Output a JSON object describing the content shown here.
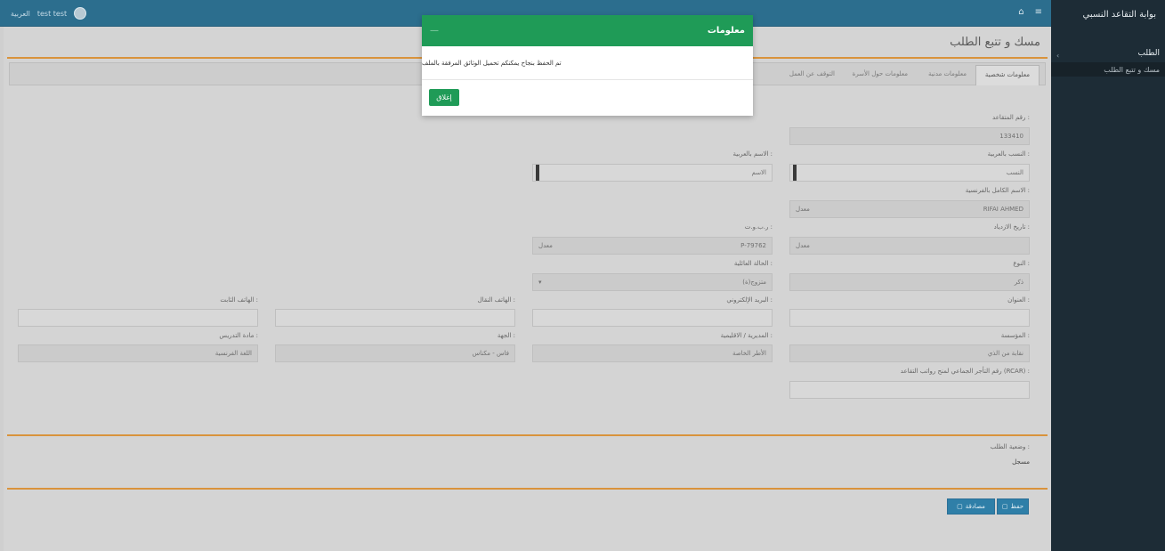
{
  "sidebar": {
    "brand": "بوابة التقاعد النسبي",
    "menu_main": "الطلب",
    "menu_sub": "مسك و تتبع الطلب"
  },
  "navbar": {
    "username": "test test",
    "language": "العربية"
  },
  "page": {
    "title": "مسك و تتبع الطلب"
  },
  "tabs": [
    {
      "label": "معلومات شخصية"
    },
    {
      "label": "معلومات مدنية"
    },
    {
      "label": "معلومات حول الأسرة"
    },
    {
      "label": "التوقف عن العمل"
    }
  ],
  "form": {
    "retiree_number": {
      "label": "رقم المتقاعد :",
      "value": "133410"
    },
    "last_name_ar": {
      "label": "النسب بالعربية :",
      "value": "النسب"
    },
    "first_name_ar": {
      "label": "الاسم بالعربية :",
      "value": "الاسم"
    },
    "full_name_fr": {
      "label": "الاسم الكامل بالفرنسية :",
      "value": "RIFAI AHMED",
      "hint": "معدل"
    },
    "birth_date": {
      "label": "تاريخ الازدياد :",
      "hint": "معدل"
    },
    "cin": {
      "label": "ر.ب.و.ت :",
      "value": "P-79762",
      "hint": "معدل"
    },
    "marital_status": {
      "label": "الحالة العائلية :",
      "value": "متزوج(ة)"
    },
    "gender": {
      "label": "النوع :",
      "value": "ذكر"
    },
    "address": {
      "label": "العنوان :",
      "value": ""
    },
    "email": {
      "label": "البريد الإلكتروني :",
      "value": ""
    },
    "mobile_phone": {
      "label": "الهاتف النقال :",
      "value": ""
    },
    "landline_phone": {
      "label": "الهاتف الثابت :",
      "value": ""
    },
    "institution": {
      "label": "المؤسسة :",
      "value": "نقابة من الذي"
    },
    "directorate": {
      "label": "المديرية / الاقليمية :",
      "value": "الأطر الخاصة"
    },
    "region": {
      "label": "الجهة :",
      "value": "فاس - مكناس"
    },
    "teaching_subject": {
      "label": "مادة التدريس :",
      "value": "اللغة الفرنسية"
    },
    "rcar_number": {
      "label": "رقم التأجر الجماعي لمنح رواتب التقاعد (RCAR) :",
      "value": ""
    }
  },
  "request_status": {
    "label": "وضعية الطلب :",
    "value": "مسجل"
  },
  "buttons": {
    "save": "حفظ",
    "confirm": "مصادقة"
  },
  "modal": {
    "title": "معلومات",
    "message": "تم الحفظ بنجاح يمكنكم تحميل الوثائق المرفقة بالملف",
    "close_button": "إغلاق"
  },
  "colors": {
    "navbar": "#2c6e8e",
    "sidebar": "#1d2c36",
    "modal_header": "#1f9b57",
    "accent_line": "#d9933c",
    "save_button": "#2f7fa8"
  }
}
